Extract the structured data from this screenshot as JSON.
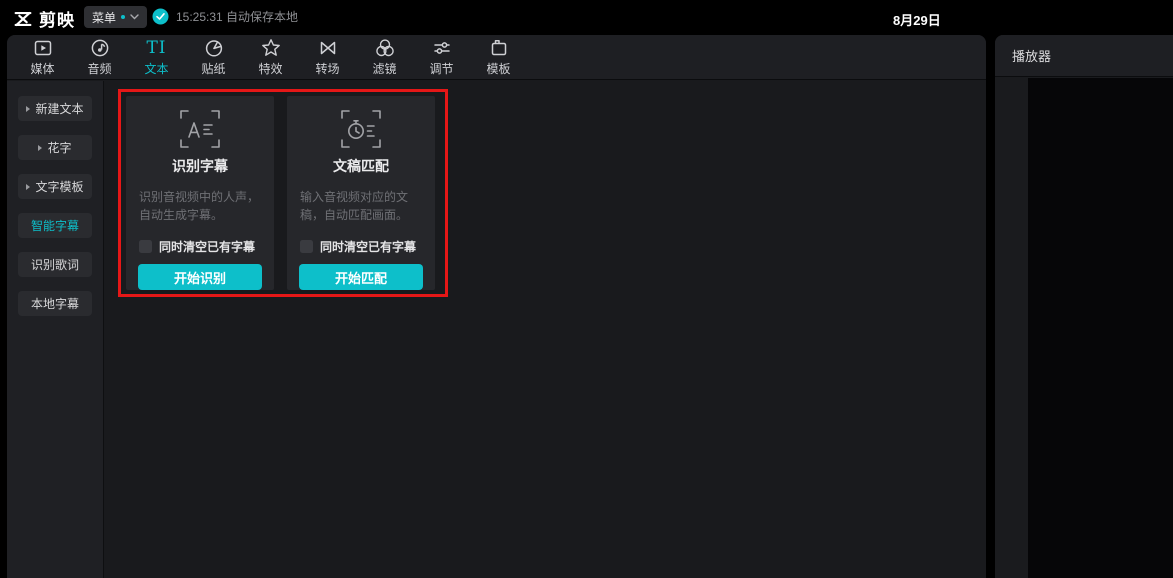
{
  "topbar": {
    "logo_text": "剪映",
    "menu_label": "菜单",
    "autosave_text": "15:25:31 自动保存本地",
    "date_text": "8月29日"
  },
  "toolbar": {
    "items": [
      {
        "label": "媒体",
        "active": false
      },
      {
        "label": "音频",
        "active": false
      },
      {
        "label": "文本",
        "active": true,
        "icon_glyph": "TI"
      },
      {
        "label": "贴纸",
        "active": false
      },
      {
        "label": "特效",
        "active": false
      },
      {
        "label": "转场",
        "active": false
      },
      {
        "label": "滤镜",
        "active": false
      },
      {
        "label": "调节",
        "active": false
      },
      {
        "label": "模板",
        "active": false
      }
    ]
  },
  "sidebar": {
    "items": [
      {
        "label": "新建文本",
        "caret": true,
        "active": false
      },
      {
        "label": "花字",
        "caret": true,
        "active": false
      },
      {
        "label": "文字模板",
        "caret": true,
        "active": false
      },
      {
        "label": "智能字幕",
        "caret": false,
        "active": true
      },
      {
        "label": "识别歌词",
        "caret": false,
        "active": false
      },
      {
        "label": "本地字幕",
        "caret": false,
        "active": false
      }
    ]
  },
  "cards": [
    {
      "title": "识别字幕",
      "description": "识别音视频中的人声，自动生成字幕。",
      "checkbox_label": "同时清空已有字幕",
      "checked": false,
      "button_label": "开始识别"
    },
    {
      "title": "文稿匹配",
      "description": "输入音视频对应的文稿，自动匹配画面。",
      "checkbox_label": "同时清空已有字幕",
      "checked": false,
      "button_label": "开始匹配"
    }
  ],
  "player": {
    "title": "播放器"
  },
  "colors": {
    "accent": "#0dbfca",
    "annotation_border": "#e51717",
    "panel": "#1e1f23",
    "card": "#26272b"
  }
}
